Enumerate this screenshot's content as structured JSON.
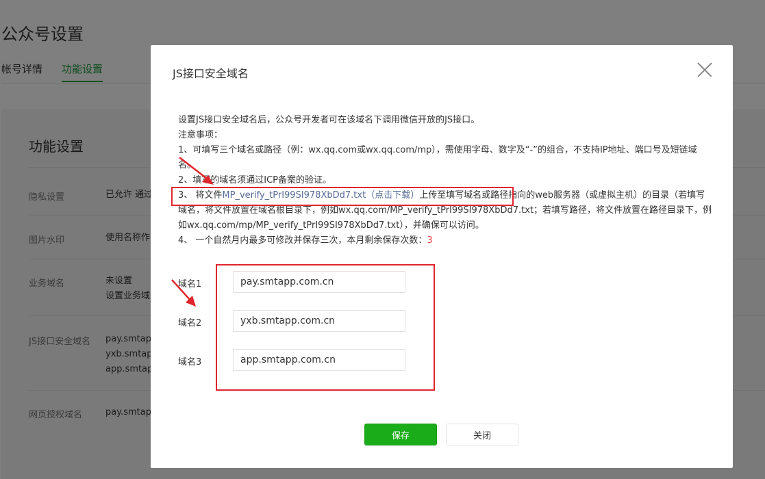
{
  "page": {
    "title": "公众号设置",
    "tabs": [
      {
        "label": "帐号详情"
      },
      {
        "label": "功能设置"
      }
    ],
    "panel_title": "功能设置",
    "rows": [
      {
        "label": "隐私设置",
        "value": "已允许 通过"
      },
      {
        "label": "图片水印",
        "value": "使用名称作"
      },
      {
        "label": "业务域名",
        "value_lines": [
          "未设置",
          "设置业务域"
        ]
      },
      {
        "label": "JS接口安全域名",
        "value_lines": [
          "pay.smtap",
          "yxb.smtap",
          "app.smtap"
        ]
      },
      {
        "label": "网页授权域名",
        "value": "pay.smtap"
      }
    ]
  },
  "modal": {
    "title": "JS接口安全域名",
    "intro": "设置JS接口安全域名后，公众号开发者可在该域名下调用微信开放的JS接口。",
    "notes_heading": "注意事项：",
    "note1": "1、可填写三个域名或路径（例：wx.qq.com或wx.qq.com/mp），需使用字母、数字及“-”的组合，不支持IP地址、端口号及短链域名。",
    "note2": "2、填写的域名须通过ICP备案的验证。",
    "note3_prefix": "3、 将文件",
    "note3_link": "MP_verify_tPrI99SI978XbDd7.txt（点击下载）",
    "note3_suffix": "上传至填写域名或路径指向的web服务器（或虚拟主机）的目录（若填写域名，将文件放置在域名根目录下，例如wx.qq.com/MP_verify_tPrI99SI978XbDd7.txt；若填写路径，将文件放置在路径目录下，例如wx.qq.com/mp/MP_verify_tPrI99SI978XbDd7.txt），并确保可以访问。",
    "note4_prefix": "4、 一个自然月内最多可修改并保存三次，本月剩余保存次数：",
    "note4_count": "3",
    "fields": [
      {
        "label": "域名1",
        "value": "pay.smtapp.com.cn"
      },
      {
        "label": "域名2",
        "value": "yxb.smtapp.com.cn"
      },
      {
        "label": "域名3",
        "value": "app.smtapp.com.cn"
      }
    ],
    "save_label": "保存",
    "close_label": "关闭"
  },
  "colors": {
    "accent_green": "#1aad19",
    "link_blue": "#576b95",
    "annotation_red": "#e0262d",
    "count_red": "#e64340",
    "overlay": "#7f7f7f"
  }
}
